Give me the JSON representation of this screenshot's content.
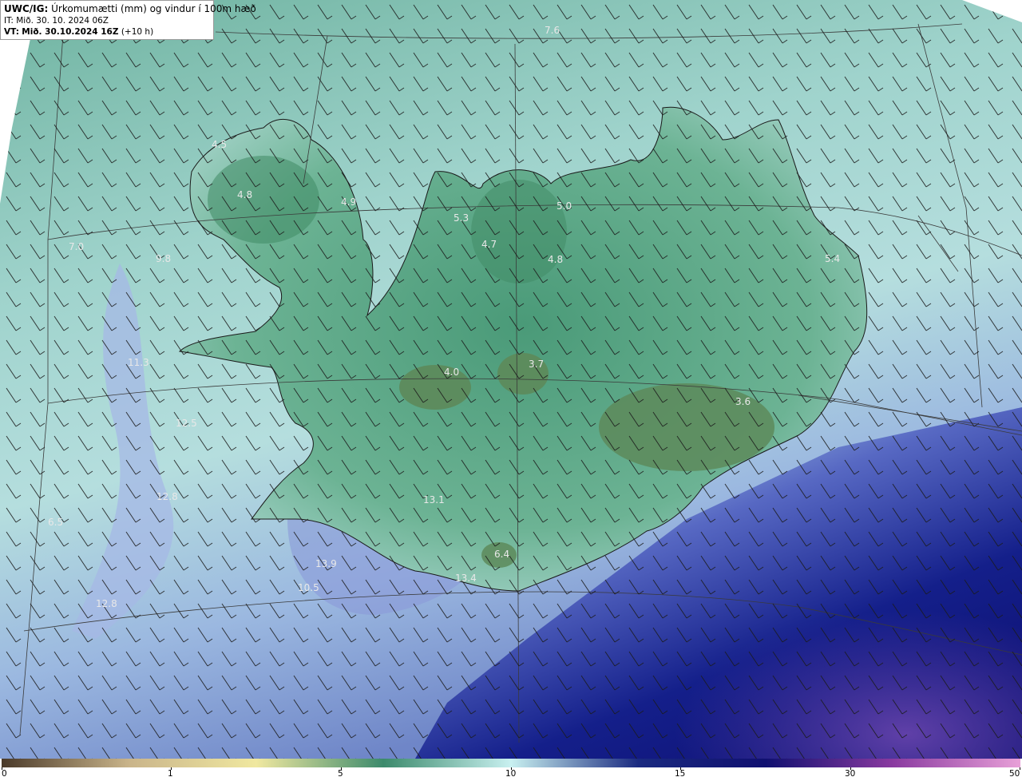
{
  "header": {
    "model": "UWC/IG:",
    "title": "Úrkomumætti (mm) og vindur í 100m hæð",
    "issue_time": "IT: Mið. 30. 10. 2024 06Z",
    "valid_prefix": "VT:",
    "valid_time": "Mið. 30.10.2024 16Z",
    "lead": "(+10 h)"
  },
  "map": {
    "values": [
      {
        "text": "7.6"
      },
      {
        "text": "4.5"
      },
      {
        "text": "4.8"
      },
      {
        "text": "4.9"
      },
      {
        "text": "5.3"
      },
      {
        "text": "4.7"
      },
      {
        "text": "4.8"
      },
      {
        "text": "5.4"
      },
      {
        "text": "7.0"
      },
      {
        "text": "9.8"
      },
      {
        "text": "4.0"
      },
      {
        "text": "3.7"
      },
      {
        "text": "3.6"
      },
      {
        "text": "12.5"
      },
      {
        "text": "12.8"
      },
      {
        "text": "13.1"
      },
      {
        "text": "6.5"
      },
      {
        "text": "6.4"
      },
      {
        "text": "13.9"
      },
      {
        "text": "13.4"
      },
      {
        "text": "10.5"
      },
      {
        "text": "12.8"
      },
      {
        "text": "5.0"
      },
      {
        "text": "11.3"
      }
    ]
  },
  "colorbar": {
    "ticks": [
      "0",
      "1",
      "5",
      "10",
      "15",
      "30",
      "50"
    ],
    "colors": [
      "#4a3a2a",
      "#c9b48a",
      "#f0e8a0",
      "#3c8a6c",
      "#c8f0f0",
      "#1a2a80",
      "#101070",
      "#8a3aa0",
      "#e8a0d8"
    ]
  }
}
